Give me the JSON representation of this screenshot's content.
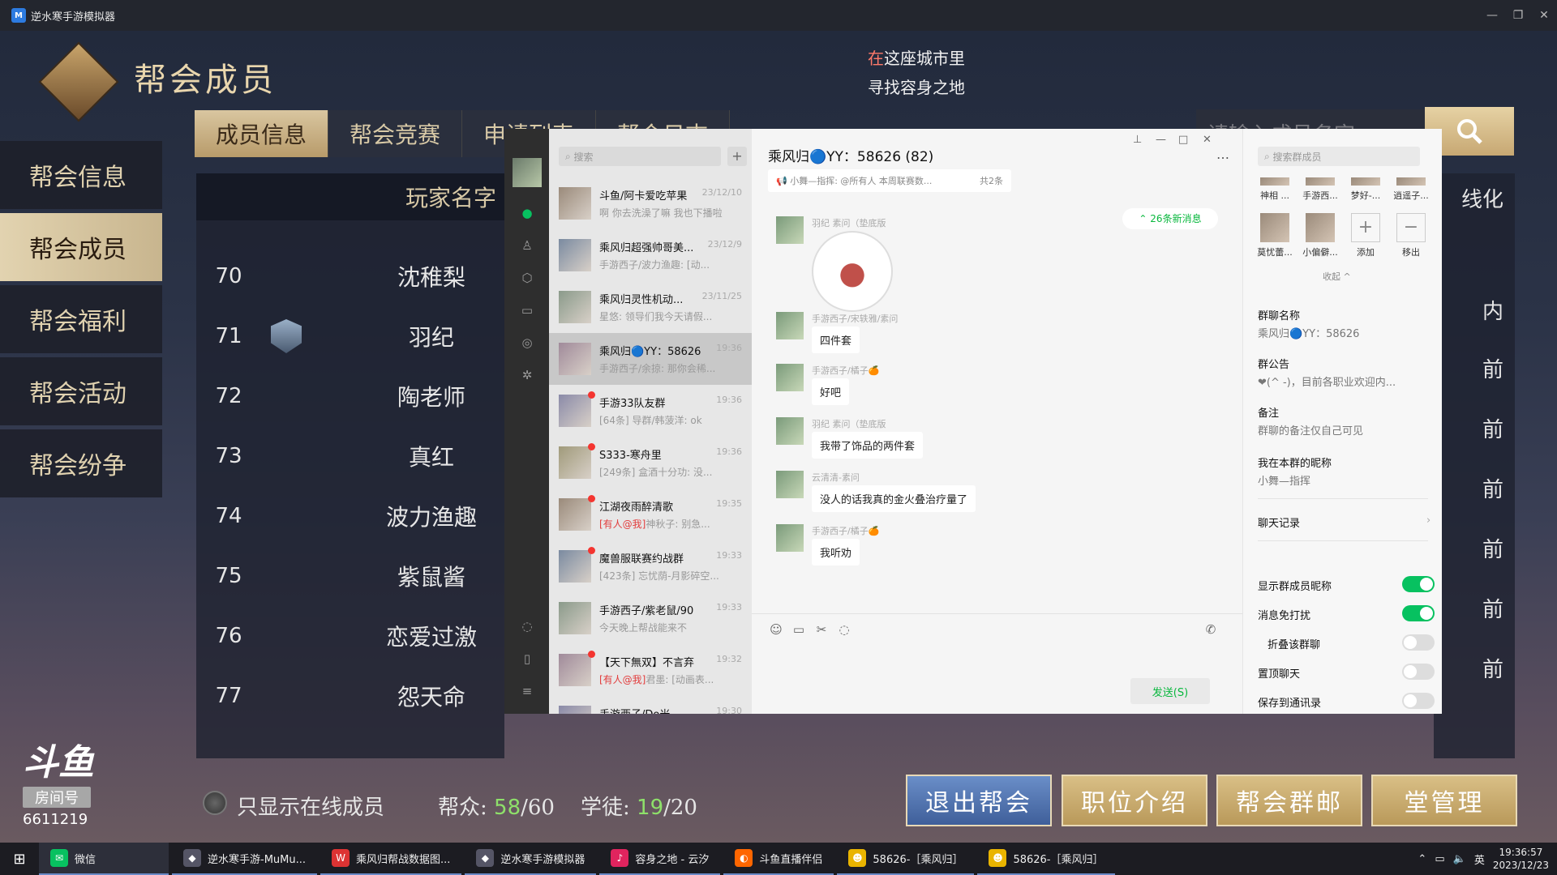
{
  "window": {
    "title": "逆水寒手游模拟器"
  },
  "game": {
    "header_title": "帮会成员",
    "lyric_line1_hl": "在",
    "lyric_line1_rest": "这座城市里",
    "lyric_line2": "寻找容身之地",
    "tabs": [
      "成员信息",
      "帮会竞赛",
      "申请列表",
      "帮会日志"
    ],
    "search_placeholder": "请输入成员名字",
    "side_menu": [
      "帮会信息",
      "帮会成员",
      "帮会福利",
      "帮会活动",
      "帮会纷争"
    ],
    "table_header": "玩家名字",
    "members": [
      {
        "rank": "70",
        "name": "沈稚梨"
      },
      {
        "rank": "71",
        "name": "羽纪"
      },
      {
        "rank": "72",
        "name": "陶老师"
      },
      {
        "rank": "73",
        "name": "真红"
      },
      {
        "rank": "74",
        "name": "波力渔趣"
      },
      {
        "rank": "75",
        "name": "紫鼠酱"
      },
      {
        "rank": "76",
        "name": "恋爱过激"
      },
      {
        "rank": "77",
        "name": "怨天命"
      }
    ],
    "right_col": {
      "header": "线化",
      "cells": [
        "内",
        "前",
        "前",
        "前",
        "前",
        "前",
        "前"
      ]
    },
    "online_only_label": "只显示在线成员",
    "members_label": "帮众:",
    "members_count": "58",
    "members_max": "/60",
    "apprentice_label": "学徒:",
    "apprentice_count": "19",
    "apprentice_max": "/20",
    "buttons": [
      "退出帮会",
      "职位介绍",
      "帮会群邮",
      "堂管理"
    ],
    "douyu": {
      "logo": "斗鱼",
      "sub": "房间号",
      "room": "6611219"
    }
  },
  "wechat": {
    "search_placeholder": "搜索",
    "conversations": [
      {
        "name": "斗鱼/阿卡爱吃苹果",
        "time": "23/12/10",
        "preview": "啊 你去洗澡了嘛 我也下播啦",
        "at": "",
        "unread": false,
        "active": false
      },
      {
        "name": "乘风归超强帅哥美...",
        "time": "23/12/9",
        "preview": "手游西子/波力渔趣: [动...",
        "at": "",
        "unread": false,
        "active": false
      },
      {
        "name": "乘风归灵性机动...",
        "time": "23/11/25",
        "preview": "星悠: 领导们我今天请假...",
        "at": "",
        "unread": false,
        "active": false
      },
      {
        "name": "乘风归🔵YY：58626",
        "time": "19:36",
        "preview": "手游西子/余掠: 那你会稀...",
        "at": "",
        "unread": false,
        "active": true
      },
      {
        "name": "手游33队友群",
        "time": "19:36",
        "preview": "[64条] 导群/韩菠洋: ok",
        "at": "",
        "unread": true,
        "active": false
      },
      {
        "name": "S333-寒舟里",
        "time": "19:36",
        "preview": "[249条] 盒酒十分功: 没...",
        "at": "",
        "unread": true,
        "active": false
      },
      {
        "name": "江湖夜雨醉清歌",
        "time": "19:35",
        "preview": "神秋子: 别急...",
        "at": "[有人@我]",
        "unread": true,
        "active": false
      },
      {
        "name": "魔兽服联赛约战群",
        "time": "19:33",
        "preview": "[423条] 忘忧荫-月影碎空...",
        "at": "",
        "unread": true,
        "active": false
      },
      {
        "name": "手游西子/紫老鼠/90",
        "time": "19:33",
        "preview": "今天晚上帮战能来不",
        "at": "",
        "unread": false,
        "active": false
      },
      {
        "name": "【天下無双】不言弃",
        "time": "19:32",
        "preview": "君墨: [动画表...",
        "at": "[有人@我]",
        "unread": true,
        "active": false
      },
      {
        "name": "手游西子/Do米",
        "time": "19:30",
        "preview": "",
        "at": "",
        "unread": false,
        "active": false
      }
    ],
    "chat": {
      "title": "乘风归🔵YY：58626 (82)",
      "notice": "小舞—指挥: @所有人 本周联赛数...",
      "notice_count": "共2条",
      "new_messages": "26条新消息",
      "messages": [
        {
          "sender": "羽纪 素问（垫底版",
          "text": "",
          "sticker": true
        },
        {
          "sender": "手游西子/宋轶雅/素问",
          "text": "四件套",
          "sticker": false
        },
        {
          "sender": "手游西子/橘子🍊",
          "text": "好吧",
          "sticker": false
        },
        {
          "sender": "羽纪 素问（垫底版",
          "text": "我带了饰品的两件套",
          "sticker": false
        },
        {
          "sender": "云清清-素问",
          "text": "没人的话我真的金火叠治疗量了",
          "sticker": false
        },
        {
          "sender": "手游西子/橘子🍊",
          "text": "我听劝",
          "sticker": false
        }
      ],
      "send_label": "发送(S)"
    },
    "panel": {
      "search_placeholder": "搜索群成员",
      "members_top": [
        "神相 ...",
        "手游西...",
        "梦好-...",
        "逍遥子..."
      ],
      "members_row2": [
        "莫忧蕾...",
        "小偏僻..."
      ],
      "add_label": "添加",
      "remove_label": "移出",
      "collapse_label": "收起 ^",
      "group_name_label": "群聊名称",
      "group_name": "乘风归🔵YY：58626",
      "announcement_label": "群公告",
      "announcement": "❤(^ -)，目前各职业欢迎内...",
      "remark_label": "备注",
      "remark": "群聊的备注仅自己可见",
      "nickname_label": "我在本群的昵称",
      "nickname": "小舞—指挥",
      "history_label": "聊天记录",
      "toggles": [
        {
          "label": "显示群成员昵称",
          "on": true
        },
        {
          "label": "消息免打扰",
          "on": true
        },
        {
          "label": "折叠该群聊",
          "on": false
        },
        {
          "label": "置顶聊天",
          "on": false
        },
        {
          "label": "保存到通讯录",
          "on": false
        }
      ]
    }
  },
  "taskbar": {
    "items": [
      "微信",
      "逆水寒手游-MuMu...",
      "乘风归帮战数据图...",
      "逆水寒手游模拟器",
      "容身之地 - 云汐",
      "斗鱼直播伴侣",
      "58626-［乘风归］",
      "58626-［乘风归］"
    ],
    "ime": "英",
    "time": "19:36:57",
    "date": "2023/12/23"
  }
}
